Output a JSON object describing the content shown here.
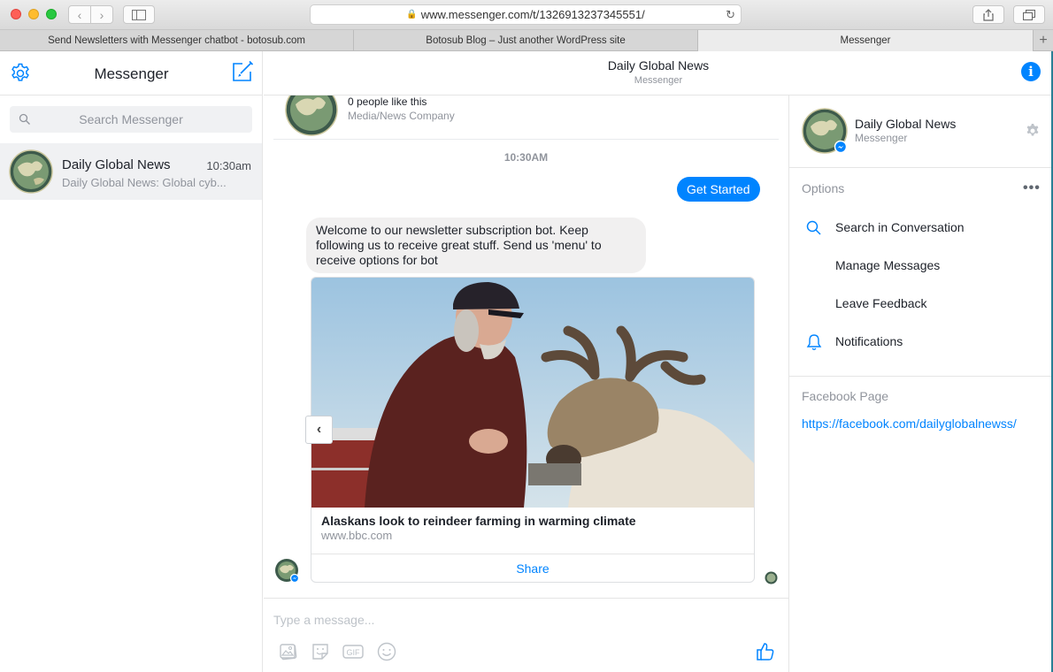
{
  "browser": {
    "url": "www.messenger.com/t/1326913237345551/",
    "tabs": [
      {
        "title": "Send Newsletters with Messenger chatbot - botosub.com"
      },
      {
        "title": "Botosub Blog – Just another WordPress site"
      },
      {
        "title": "Messenger"
      }
    ],
    "new_tab": "+"
  },
  "sidebar": {
    "title": "Messenger",
    "search_placeholder": "Search Messenger",
    "conversations": [
      {
        "name": "Daily Global News",
        "time": "10:30am",
        "snippet": "Daily Global News: Global cyb..."
      }
    ]
  },
  "chat": {
    "header_title": "Daily Global News",
    "header_subtitle": "Messenger",
    "page_likes": "0 people like this",
    "page_category": "Media/News Company",
    "timestamp": "10:30AM",
    "sent_message": "Get Started",
    "received_message": "Welcome to our newsletter subscription bot. Keep following us to receive great stuff. Send us 'menu' to receive options for bot",
    "card": {
      "title": "Alaskans look to reindeer farming in warming climate",
      "domain": "www.bbc.com",
      "button": "Share"
    },
    "composer_placeholder": "Type a message..."
  },
  "right_panel": {
    "name": "Daily Global News",
    "subtitle": "Messenger",
    "options_label": "Options",
    "options": [
      {
        "label": "Search in Conversation",
        "icon": "search-icon"
      },
      {
        "label": "Manage Messages",
        "icon": ""
      },
      {
        "label": "Leave Feedback",
        "icon": ""
      },
      {
        "label": "Notifications",
        "icon": "bell-icon"
      }
    ],
    "facebook_page_label": "Facebook Page",
    "facebook_page_url": "https://facebook.com/dailyglobalnewss/"
  },
  "colors": {
    "accent": "#0084ff",
    "bubble_gray": "#f1f0f0",
    "muted_text": "#90949c"
  }
}
